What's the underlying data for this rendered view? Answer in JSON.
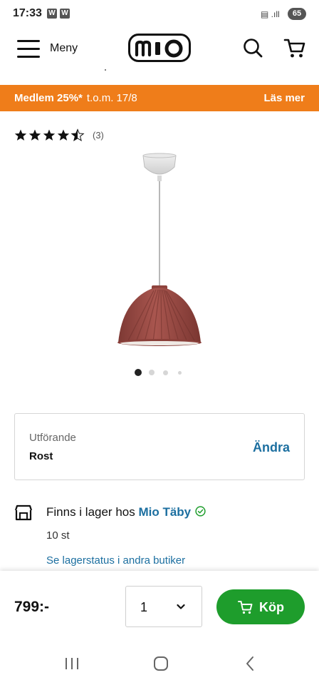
{
  "status_bar": {
    "time": "17:33",
    "app_badges": [
      "W",
      "W"
    ],
    "signal": "▤ .ıll",
    "battery": "65"
  },
  "header": {
    "menu_label": "Meny",
    "logo_text": "mio",
    "icons": [
      "menu-icon",
      "search-icon",
      "cart-icon"
    ]
  },
  "promo": {
    "highlight": "Medlem 25%*",
    "text": "t.o.m. 17/8",
    "link": "Läs mer",
    "color": "#ef7d1a"
  },
  "rating": {
    "stars": 4.5,
    "max": 5,
    "count": "(3)"
  },
  "carousel": {
    "active_index": 0,
    "dot_count": 4
  },
  "variant": {
    "label": "Utförande",
    "value": "Rost",
    "action": "Ändra"
  },
  "stock": {
    "text": "Finns i lager hos",
    "store": "Mio Täby",
    "quantity": "10 st",
    "link": "Se lagerstatus i andra butiker"
  },
  "buy_bar": {
    "price": "799:-",
    "quantity": "1",
    "button": "Köp",
    "button_color": "#1e9d2c"
  },
  "colors": {
    "accent_blue": "#1c6fa0",
    "lamp_shade": "#9a4a44"
  }
}
